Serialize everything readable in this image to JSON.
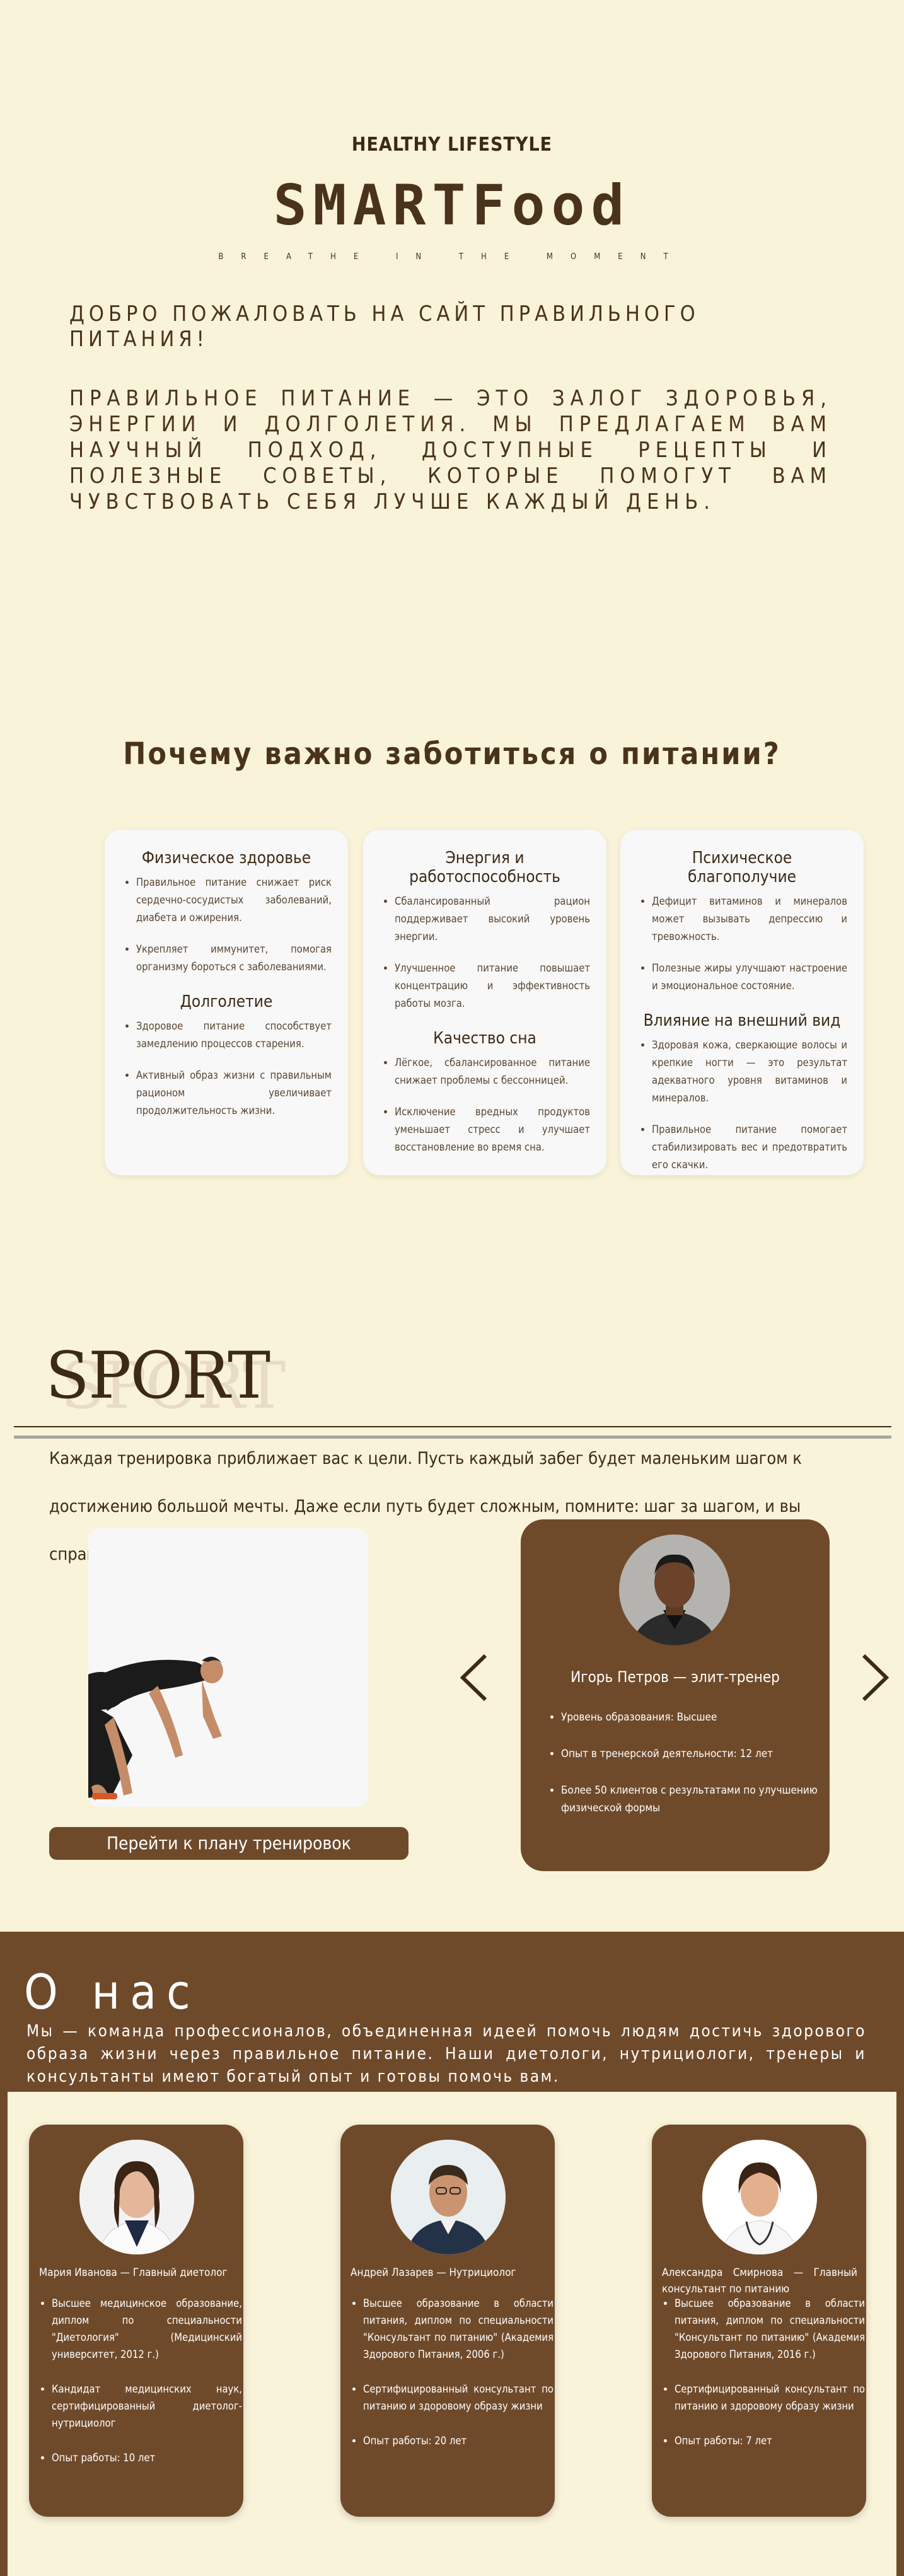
{
  "hero": {
    "kicker": "HEALTHY LIFESTYLE",
    "logo": "SMARTFood",
    "tagline": "BREATHE IN THE MOMENT",
    "welcome": "Добро пожаловать на сайт правильного питания!",
    "intro": "Правильное питание — это залог здоровья, энергии и долголетия. Мы предлагаем вам научный подход, доступные рецепты и полезные советы, которые помогут вам чувствовать себя лучше каждый день."
  },
  "why": {
    "title": "Почему важно заботиться о питании?",
    "cards": [
      {
        "sections": [
          {
            "heading": "Физическое здоровье",
            "items": [
              "Правильное питание снижает риск сердечно-сосудистых заболеваний, диабета и ожирения.",
              "Укрепляет иммунитет, помогая организму бороться с заболеваниями."
            ]
          },
          {
            "heading": "Долголетие",
            "items": [
              "Здоровое питание способствует замедлению процессов старения.",
              "Активный образ жизни с правильным рационом увеличивает продолжительность жизни."
            ]
          }
        ]
      },
      {
        "sections": [
          {
            "heading": "Энергия и работоспособность",
            "items": [
              "Сбалансированный рацион поддерживает высокий уровень энергии.",
              "Улучшенное питание повышает концентрацию и эффективность работы мозга."
            ]
          },
          {
            "heading": "Качество сна",
            "items": [
              "Лёгкое, сбалансированное питание снижает проблемы с бессонницей.",
              "Исключение вредных продуктов уменьшает стресс и улучшает восстановление во время сна."
            ]
          }
        ]
      },
      {
        "sections": [
          {
            "heading": "Психическое благополучие",
            "items": [
              "Дефицит витаминов и минералов может вызывать депрессию и тревожность.",
              "Полезные жиры улучшают настроение и эмоциональное состояние."
            ]
          },
          {
            "heading": "Влияние на внешний вид",
            "items": [
              "Здоровая кожа, сверкающие волосы и крепкие ногти — это результат адекватного уровня витаминов и минералов.",
              "Правильное питание помогает стабилизировать вес и предотвратить его скачки."
            ]
          }
        ]
      }
    ]
  },
  "sport": {
    "title": "SPORT",
    "text": "Каждая тренировка приближает вас к цели. Пусть каждый забег будет маленьким шагом к достижению большой мечты. Даже если путь будет сложным, помните: шаг за шагом, и вы справитесь!",
    "plan_button": "Перейти к плану тренировок",
    "trainer": {
      "name": "Игорь Петров — элит-тренер",
      "items": [
        "Уровень образования: Высшее",
        "Опыт в тренерской деятельности: 12 лет",
        "Более 50 клиентов с результатами по улучшению физической формы"
      ]
    }
  },
  "about": {
    "title": "О нас",
    "text": "Мы — команда профессионалов, объединенная идеей помочь людям достичь здорового образа жизни через правильное питание. Наши диетологи, нутрициологи, тренеры и консультанты имеют богатый опыт и готовы помочь вам.",
    "team": [
      {
        "name": "Мария Иванова — Главный диетолог",
        "items": [
          "Высшее медицинское образование, диплом по специальности \"Диетология\" (Медицинский университет, 2012 г.)",
          "Кандидат медицинских наук, сертифицированный диетолог-нутрициолог",
          "Опыт работы: 10 лет"
        ]
      },
      {
        "name": "Андрей Лазарев — Нутрициолог",
        "items": [
          "Высшее образование в области питания, диплом по специальности \"Консультант по питанию\" (Академия Здорового Питания, 2006 г.)",
          "Сертифицированный консультант по питанию и здоровому образу жизни",
          "Опыт работы: 20 лет"
        ]
      },
      {
        "name": "Александра Смирнова — Главный консультант по питанию",
        "items": [
          "Высшее образование в области питания, диплом по специальности \"Консультант по питанию\" (Академия Здорового Питания, 2016 г.)",
          "Сертифицированный консультант по питанию и здоровому образу жизни",
          "Опыт работы: 7 лет"
        ]
      }
    ]
  },
  "colors": {
    "background": "#f9f3d9",
    "brown": "#6f4a2a",
    "dark_text": "#3d2a16"
  },
  "icons": {
    "prev": "chevron-left-icon",
    "next": "chevron-right-icon"
  }
}
